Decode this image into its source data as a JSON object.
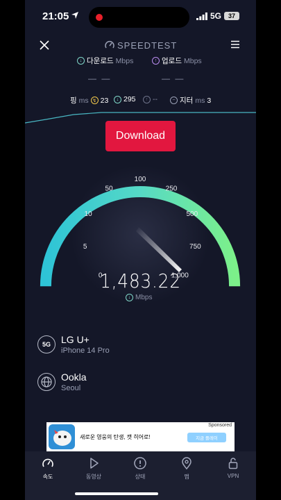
{
  "status_bar": {
    "time": "21:05",
    "network": "5G",
    "battery": "37"
  },
  "header": {
    "logo": "SPEEDTEST"
  },
  "metrics": {
    "download_label": "다운로드",
    "download_unit": "Mbps",
    "download_value": "— —",
    "upload_label": "업로드",
    "upload_unit": "Mbps",
    "upload_value": "— —"
  },
  "stats": {
    "ping_label": "핑",
    "ping_unit": "ms",
    "ping_value": "23",
    "down_ping": "295",
    "up_ping": "--",
    "jitter_label": "지터",
    "jitter_unit": "ms",
    "jitter_value": "3"
  },
  "test": {
    "button_label": "Download",
    "speed": "1,483.22",
    "speed_unit": "Mbps",
    "gauge_max_mbps": 1000,
    "needle_reading_mbps": 1000
  },
  "gauge_labels": [
    "0",
    "5",
    "10",
    "50",
    "100",
    "250",
    "500",
    "750",
    "1,000"
  ],
  "provider": {
    "badge": "5G",
    "name": "LG U+",
    "device": "iPhone 14 Pro"
  },
  "server": {
    "name": "Ookla",
    "city": "Seoul"
  },
  "ad": {
    "sponsored": "Sponsored",
    "text": "새로운 영웅의 탄생, 캣 히어로!",
    "cta": "지금 플레이"
  },
  "nav": [
    {
      "label": "속도",
      "icon": "speedometer-icon"
    },
    {
      "label": "동영상",
      "icon": "play-icon"
    },
    {
      "label": "상태",
      "icon": "alert-icon"
    },
    {
      "label": "맵",
      "icon": "map-pin-icon"
    },
    {
      "label": "VPN",
      "icon": "lock-icon"
    }
  ],
  "colors": {
    "background": "#141728",
    "accent_red": "#e2173f",
    "gauge_start": "#2ec4d6",
    "gauge_end": "#7cf08a"
  }
}
